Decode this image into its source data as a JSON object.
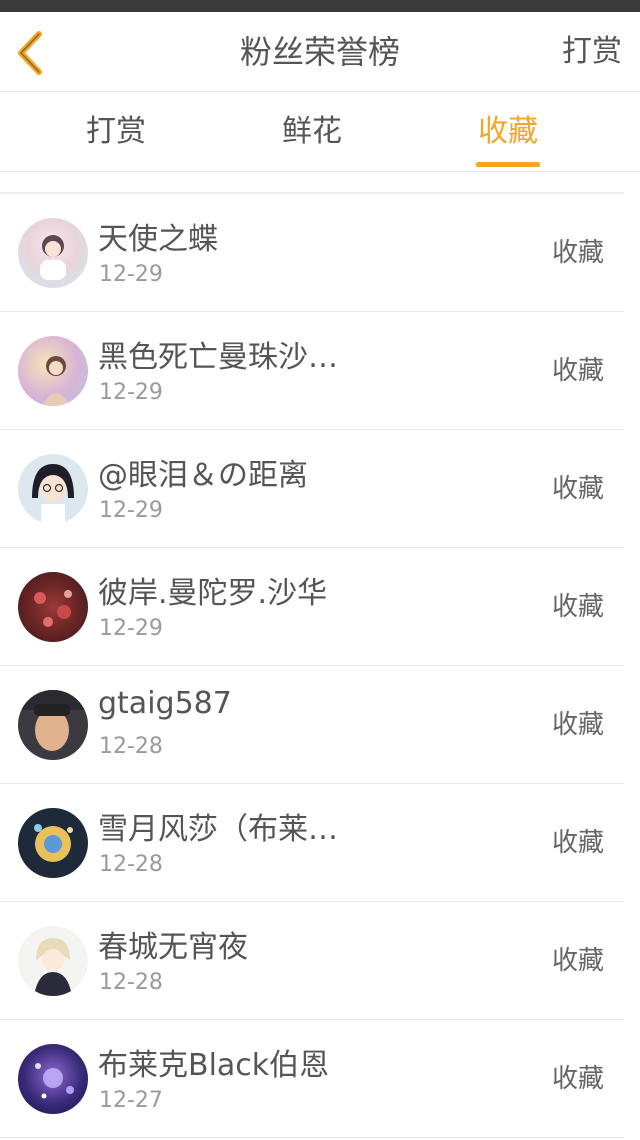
{
  "nav": {
    "title": "粉丝荣誉榜",
    "right_label": "打赏",
    "accent_color": "#f5a623"
  },
  "tabs": [
    {
      "label": "打赏",
      "active": false
    },
    {
      "label": "鲜花",
      "active": false
    },
    {
      "label": "收藏",
      "active": true
    }
  ],
  "rows": [
    {
      "name": "天使之蝶",
      "date": "12-29",
      "action": "收藏"
    },
    {
      "name": "黑色死亡曼珠沙…",
      "date": "12-29",
      "action": "收藏"
    },
    {
      "name": "@眼泪＆の距离",
      "date": "12-29",
      "action": "收藏"
    },
    {
      "name": "彼岸.曼陀罗.沙华",
      "date": "12-29",
      "action": "收藏"
    },
    {
      "name": "gtaig587",
      "date": "12-28",
      "action": "收藏"
    },
    {
      "name": "雪月风莎（布莱…",
      "date": "12-28",
      "action": "收藏"
    },
    {
      "name": "春城无宵夜",
      "date": "12-28",
      "action": "收藏"
    },
    {
      "name": "布莱克Black伯恩",
      "date": "12-27",
      "action": "收藏"
    }
  ]
}
